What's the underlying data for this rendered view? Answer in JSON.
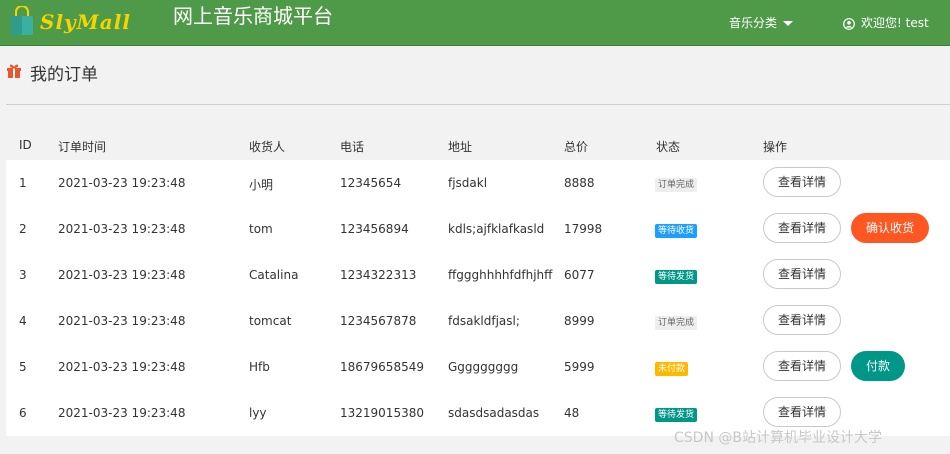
{
  "header": {
    "logo_text": "SlyMall",
    "site_title": "网上音乐商城平台",
    "nav_music": "音乐分类",
    "nav_user": "欢迎您! test"
  },
  "page": {
    "title": "我的订单"
  },
  "table": {
    "columns": [
      "ID",
      "订单时间",
      "收货人",
      "电话",
      "地址",
      "总价",
      "状态",
      "操作"
    ],
    "rows": [
      {
        "id": "1",
        "time": "2021-03-23 19:23:48",
        "name": "小明",
        "phone": "12345654",
        "addr": "fjsdakl",
        "price": "8888",
        "status": "订单完成",
        "status_color": "#eeeeee",
        "status_text_color": "#666666",
        "detail": "查看详情",
        "action": "",
        "action_color": ""
      },
      {
        "id": "2",
        "time": "2021-03-23 19:23:48",
        "name": "tom",
        "phone": "123456894",
        "addr": "kdls;ajfklafkasld",
        "price": "17998",
        "status": "等待收货",
        "status_color": "#1e9fff",
        "status_text_color": "#ffffff",
        "detail": "查看详情",
        "action": "确认收货",
        "action_color": "#ff5722"
      },
      {
        "id": "3",
        "time": "2021-03-23 19:23:48",
        "name": "Catalina",
        "phone": "1234322313",
        "addr": "ffggghhhhfdfhjhff",
        "price": "6077",
        "status": "等待发货",
        "status_color": "#009688",
        "status_text_color": "#ffffff",
        "detail": "查看详情",
        "action": "",
        "action_color": ""
      },
      {
        "id": "4",
        "time": "2021-03-23 19:23:48",
        "name": "tomcat",
        "phone": "1234567878",
        "addr": "fdsakldfjasl;",
        "price": "8999",
        "status": "订单完成",
        "status_color": "#eeeeee",
        "status_text_color": "#666666",
        "detail": "查看详情",
        "action": "",
        "action_color": ""
      },
      {
        "id": "5",
        "time": "2021-03-23 19:23:48",
        "name": "Hfb",
        "phone": "18679658549",
        "addr": "Ggggggggg",
        "price": "5999",
        "status": "未付款",
        "status_color": "#ffb800",
        "status_text_color": "#ffffff",
        "detail": "查看详情",
        "action": "付款",
        "action_color": "#009688"
      },
      {
        "id": "6",
        "time": "2021-03-23 19:23:48",
        "name": "lyy",
        "phone": "13219015380",
        "addr": "sdasdsadasdas",
        "price": "48",
        "status": "等待发货",
        "status_color": "#009688",
        "status_text_color": "#ffffff",
        "detail": "查看详情",
        "action": "",
        "action_color": ""
      }
    ]
  },
  "watermark": "CSDN @B站计算机毕业设计大学"
}
